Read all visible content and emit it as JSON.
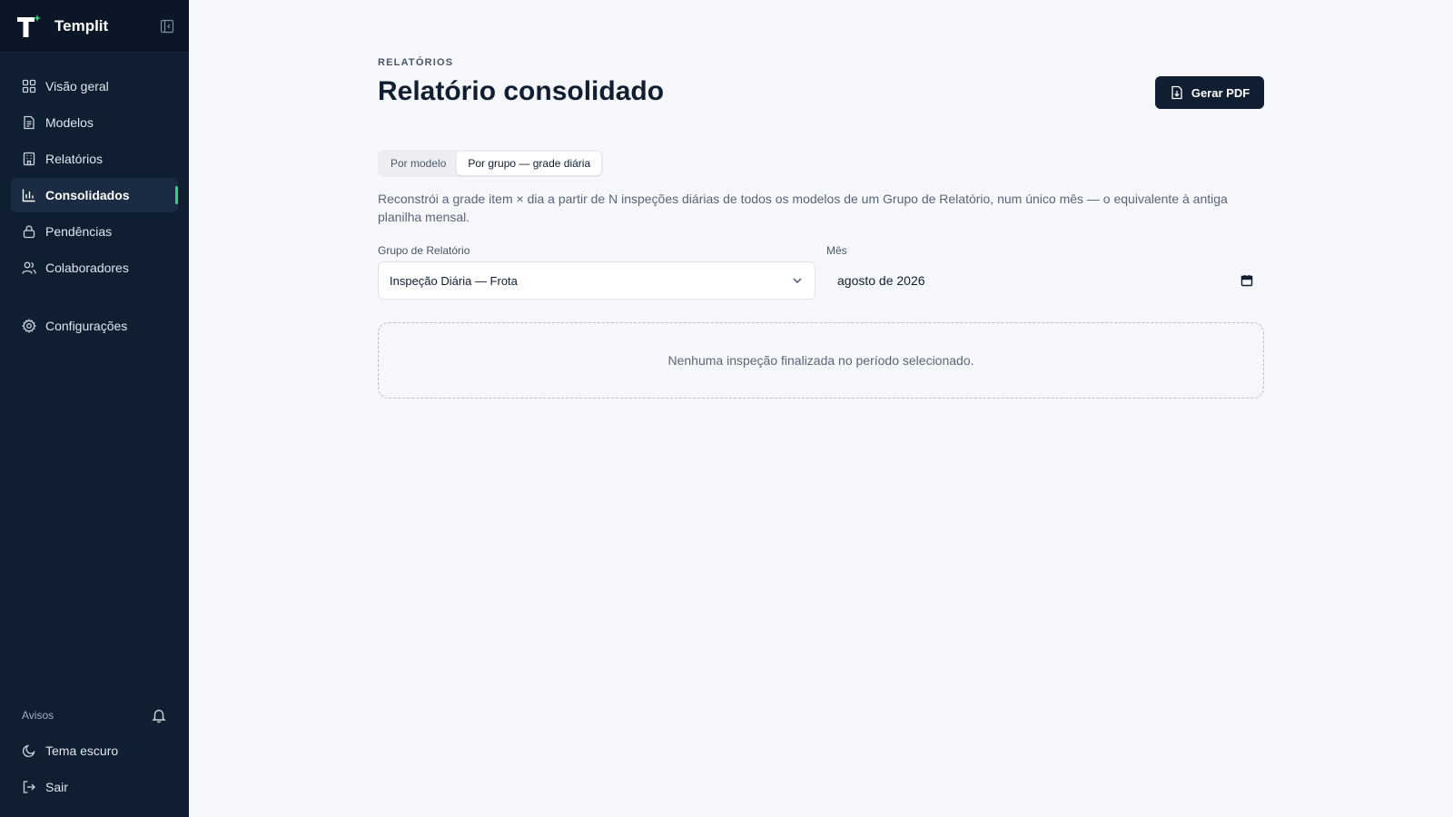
{
  "brand": {
    "name": "Templit"
  },
  "sidebar": {
    "items": [
      {
        "label": "Visão geral",
        "icon": "grid-icon"
      },
      {
        "label": "Modelos",
        "icon": "document-icon"
      },
      {
        "label": "Relatórios",
        "icon": "building-icon"
      },
      {
        "label": "Consolidados",
        "icon": "bar-chart-icon",
        "active": true
      },
      {
        "label": "Pendências",
        "icon": "lock-icon"
      },
      {
        "label": "Colaboradores",
        "icon": "users-icon"
      }
    ],
    "settings_label": "Configurações",
    "avisos_label": "Avisos",
    "theme_label": "Tema escuro",
    "logout_label": "Sair"
  },
  "page": {
    "eyebrow": "RELATÓRIOS",
    "title": "Relatório consolidado",
    "pdf_button_label": "Gerar PDF"
  },
  "tabs": [
    {
      "label": "Por modelo",
      "active": false
    },
    {
      "label": "Por grupo — grade diária",
      "active": true
    }
  ],
  "description": "Reconstrói a grade item × dia a partir de N inspeções diárias de todos os modelos de um Grupo de Relatório, num único mês — o equivalente à antiga planilha mensal.",
  "filters": {
    "group_label": "Grupo de Relatório",
    "group_value": "Inspeção Diária — Frota",
    "month_label": "Mês",
    "month_value": "agosto de 2026"
  },
  "empty_state": "Nenhuma inspeção finalizada no período selecionado.",
  "colors": {
    "sidebar_bg": "#0f1e30",
    "accent_green": "#2ed47a",
    "page_bg": "#f6f7fa",
    "primary_button": "#0f1e30"
  }
}
